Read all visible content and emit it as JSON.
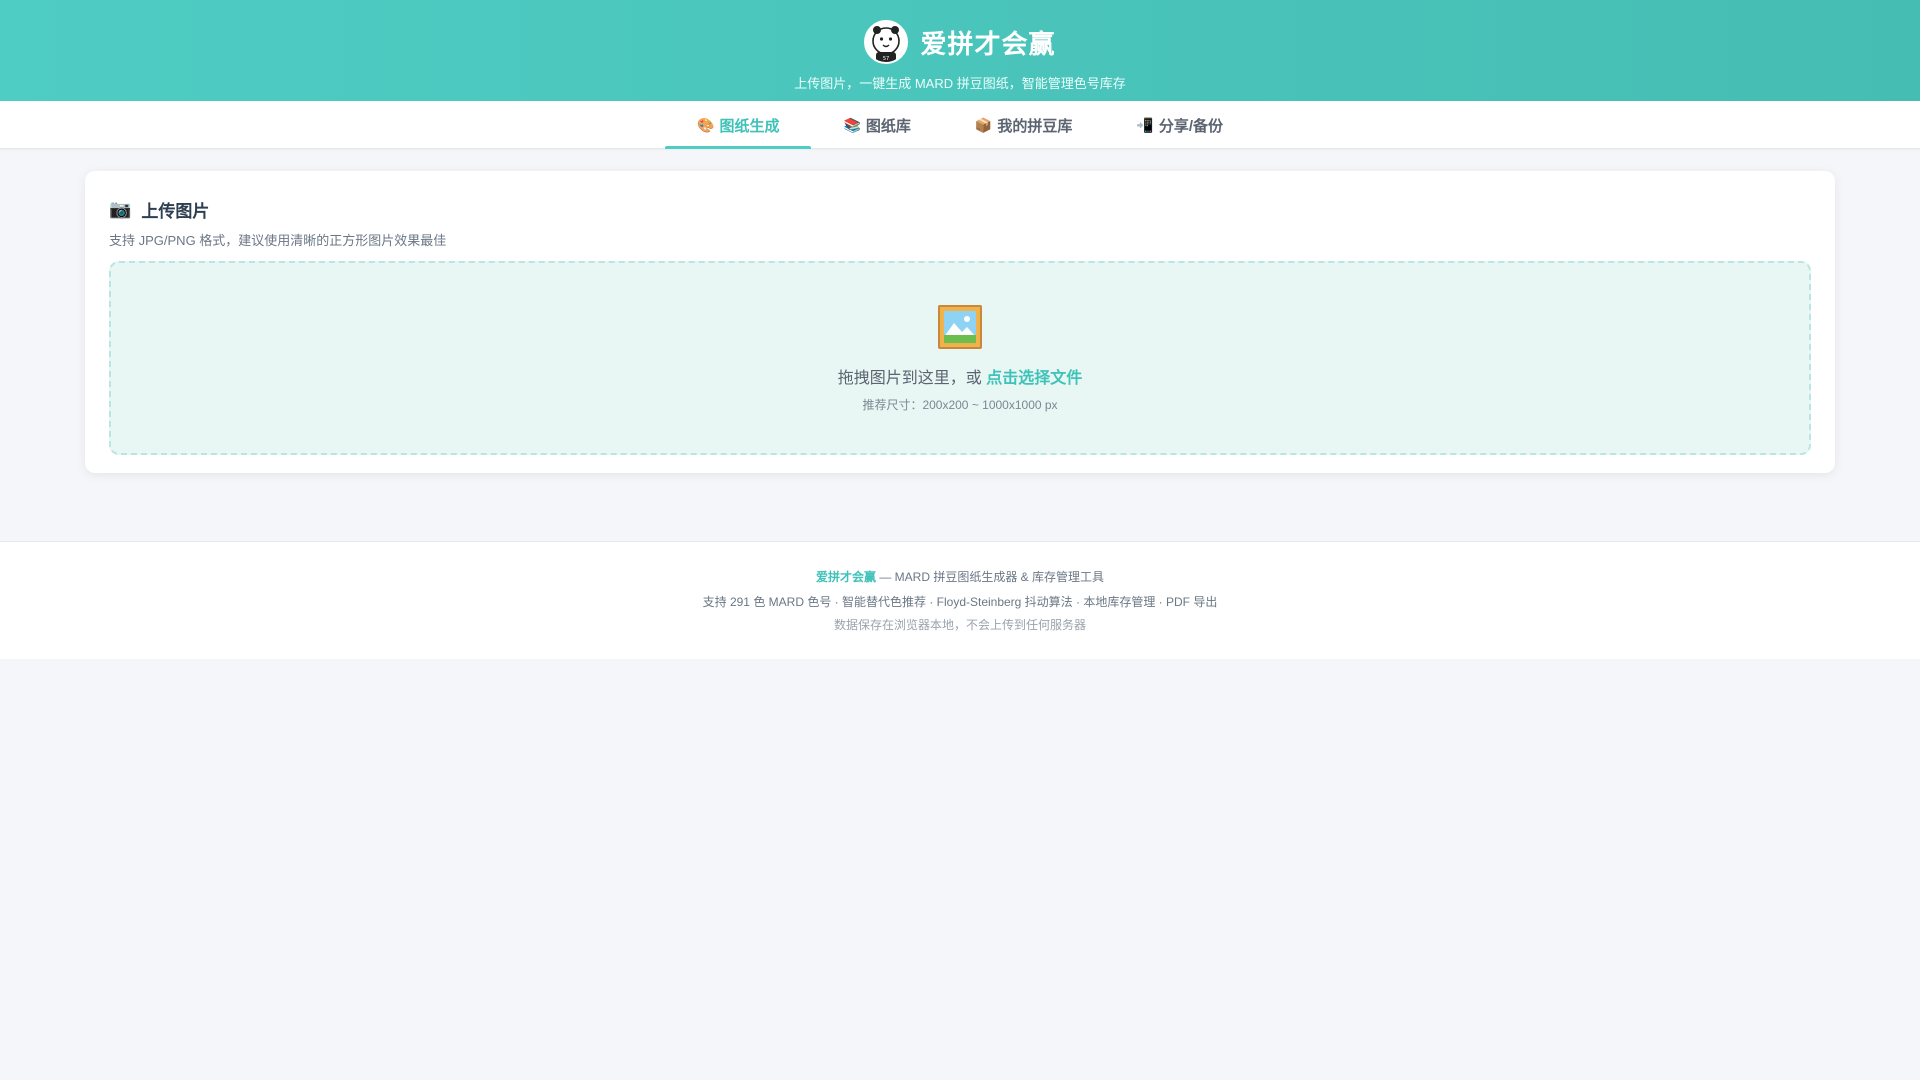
{
  "header": {
    "title": "爱拼才会赢",
    "subtitle": "上传图片，一键生成 MARD 拼豆图纸，智能管理色号库存",
    "logo_icon": "panda-avatar-icon"
  },
  "tabs": [
    {
      "icon": "🎨",
      "label": "图纸生成",
      "active": true
    },
    {
      "icon": "📚",
      "label": "图纸库",
      "active": false
    },
    {
      "icon": "📦",
      "label": "我的拼豆库",
      "active": false
    },
    {
      "icon": "📲",
      "label": "分享/备份",
      "active": false
    }
  ],
  "upload": {
    "icon": "📷",
    "title": "上传图片",
    "description": "支持 JPG/PNG 格式，建议使用清晰的正方形图片效果最佳",
    "drop_icon": "framed-picture-icon",
    "drop_text": "拖拽图片到这里，或",
    "drop_link": "点击选择文件",
    "hint": "推荐尺寸：200x200 ~ 1000x1000 px"
  },
  "footer": {
    "brand": "爱拼才会赢",
    "tagline": " — MARD 拼豆图纸生成器 & 库存管理工具",
    "features": "支持 291 色 MARD 色号 · 智能替代色推荐 · Floyd-Steinberg 抖动算法 · 本地库存管理 · PDF 导出",
    "privacy": "数据保存在浏览器本地，不会上传到任何服务器"
  },
  "colors": {
    "accent": "#4ecdc4",
    "accent_text": "#3fc2b8",
    "dropzone_bg": "#e8f7f4"
  }
}
